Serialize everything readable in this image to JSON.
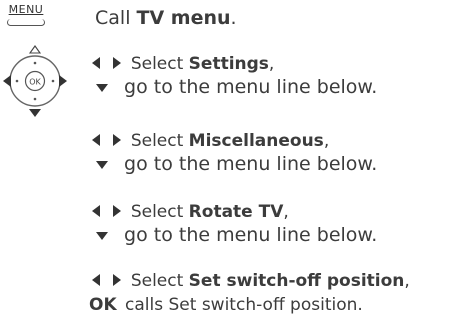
{
  "menu_key": {
    "label": "MENU"
  },
  "dpad": {
    "center_label": "OK"
  },
  "steps": [
    {
      "prefix": "Call ",
      "bold": "TV menu",
      "suffix": "."
    },
    {
      "prefix": "Select ",
      "bold": "Settings",
      "suffix": ",",
      "line2": "go to the menu line below."
    },
    {
      "prefix": "Select ",
      "bold": "Miscellaneous",
      "suffix": ",",
      "line2": "go to the menu line below."
    },
    {
      "prefix": "Select ",
      "bold": "Rotate TV",
      "suffix": ",",
      "line2": "go to the menu line below."
    },
    {
      "prefix": "Select ",
      "bold": "Set switch-off position",
      "suffix": ",",
      "ok_key": "OK",
      "line2": "calls Set switch-off position."
    }
  ],
  "colors": {
    "text": "#3c3c3c",
    "icon": "#333333"
  }
}
